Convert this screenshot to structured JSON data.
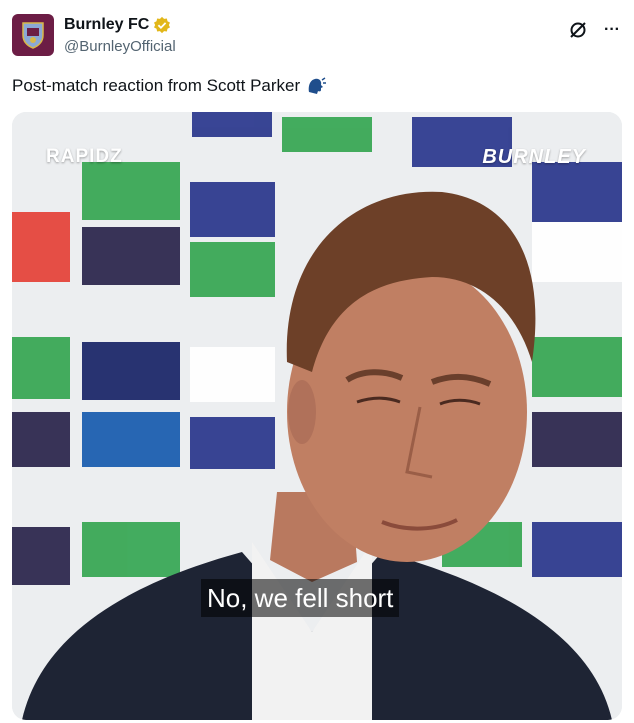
{
  "account": {
    "display_name": "Burnley FC",
    "handle": "@BurnleyOfficial",
    "verified_badge": "gold-verified",
    "avatar_icon": "burnley-crest-icon",
    "avatar_color": "#6c1d45"
  },
  "actions": {
    "grok_icon": "grok-icon",
    "more_icon": "more-dots-icon",
    "more_label": "···"
  },
  "tweet": {
    "text": "Post-match reaction from Scott Parker",
    "emoji_icon": "speaking-head-icon"
  },
  "video": {
    "watermark_left": "RAPIDZ",
    "watermark_right": "BURNLEY",
    "caption": "No, we fell short"
  }
}
